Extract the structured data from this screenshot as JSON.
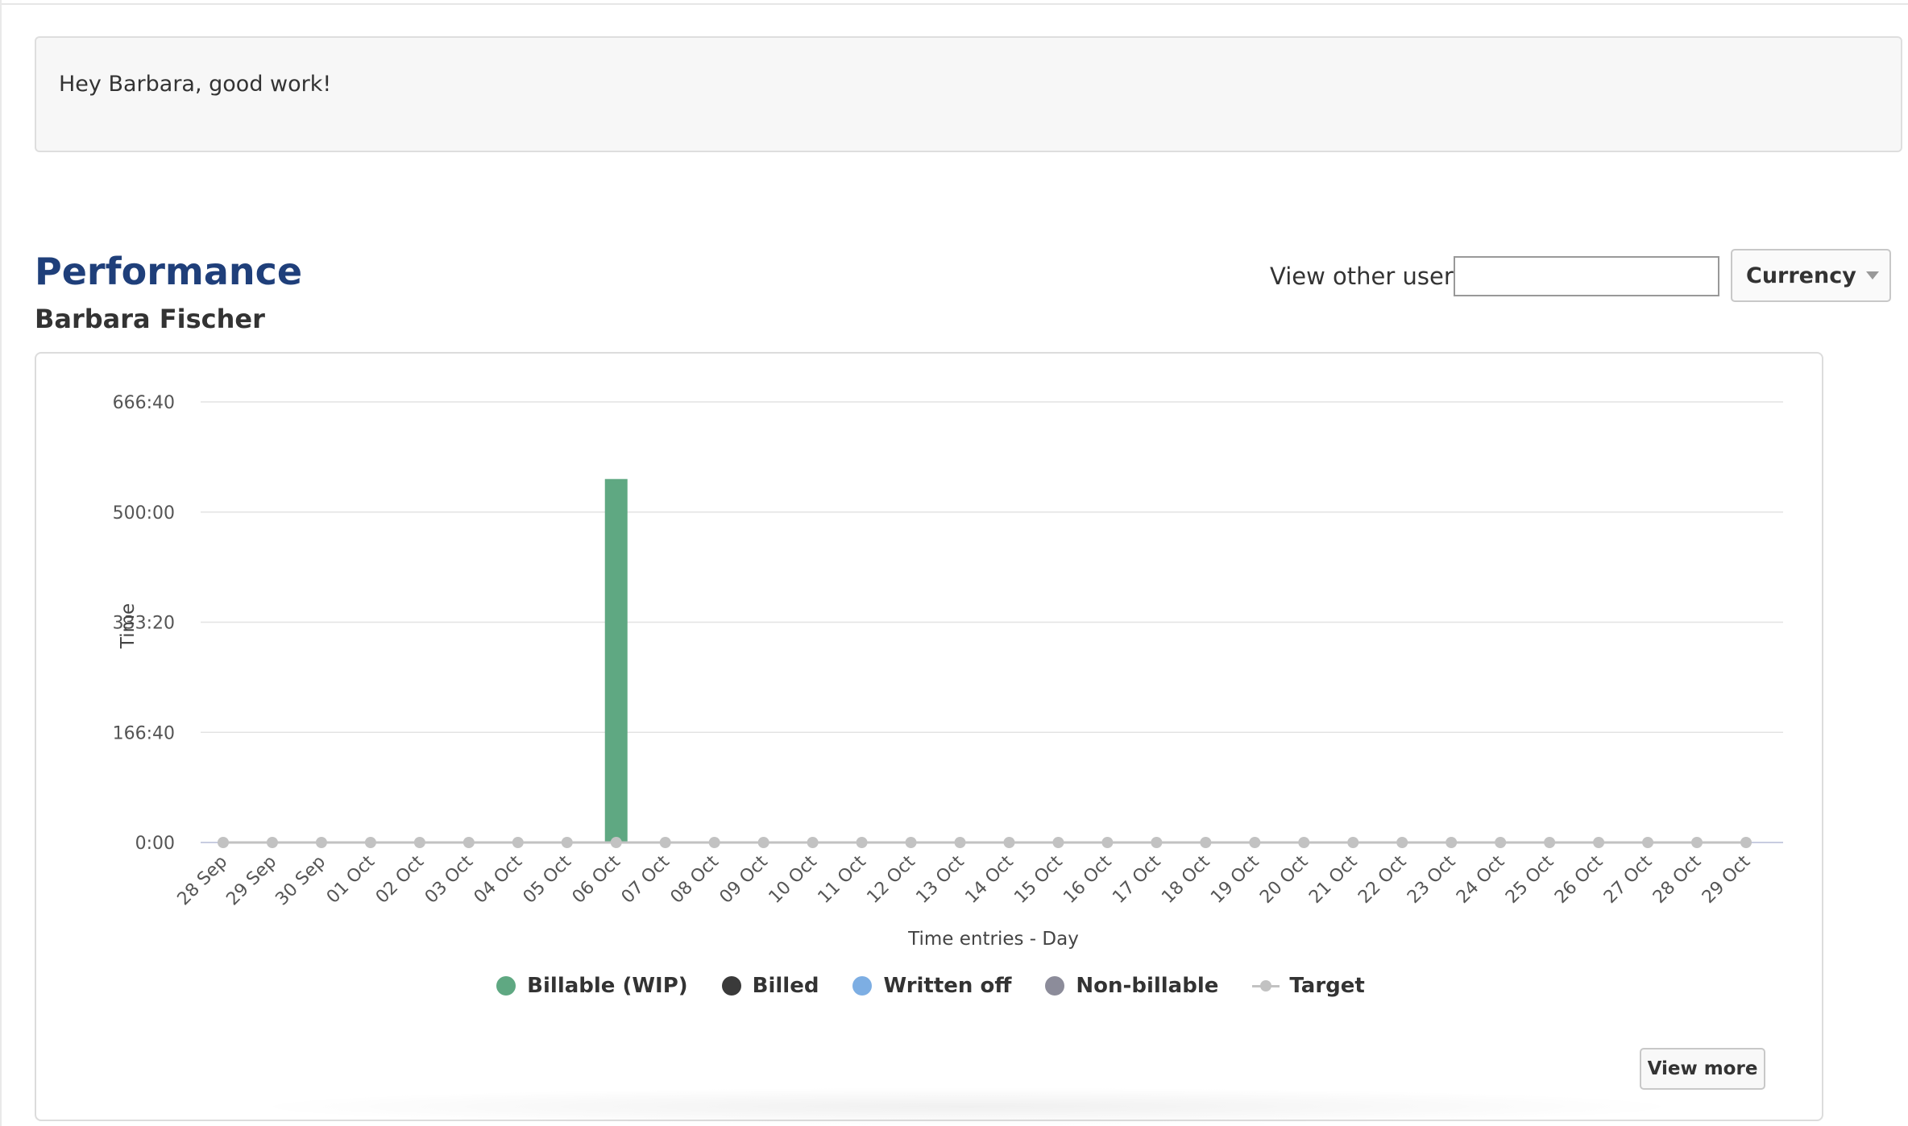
{
  "greeting": "Hey Barbara, good work!",
  "performance": {
    "title": "Performance",
    "user_name": "Barbara Fischer",
    "view_other_user_label": "View other user:",
    "view_other_user_value": "",
    "currency_label": "Currency",
    "view_more_label": "View more"
  },
  "colors": {
    "title": "#1f3f7a",
    "billable": "#5fa882",
    "billed": "#3a3a3a",
    "written_off": "#7daee3",
    "non_billable": "#8c8c9a",
    "target": "#c2c2c2"
  },
  "chart_data": {
    "type": "bar",
    "xlabel": "Time entries - Day",
    "ylabel": "Time",
    "y_ticks": [
      "0:00",
      "166:40",
      "333:20",
      "500:00",
      "666:40"
    ],
    "ylim_minutes": [
      0,
      40000
    ],
    "categories": [
      "28 Sep",
      "29 Sep",
      "30 Sep",
      "01 Oct",
      "02 Oct",
      "03 Oct",
      "04 Oct",
      "05 Oct",
      "06 Oct",
      "07 Oct",
      "08 Oct",
      "09 Oct",
      "10 Oct",
      "11 Oct",
      "12 Oct",
      "13 Oct",
      "14 Oct",
      "15 Oct",
      "16 Oct",
      "17 Oct",
      "18 Oct",
      "19 Oct",
      "20 Oct",
      "21 Oct",
      "22 Oct",
      "23 Oct",
      "24 Oct",
      "25 Oct",
      "26 Oct",
      "27 Oct",
      "28 Oct",
      "29 Oct"
    ],
    "series": [
      {
        "name": "Billable (WIP)",
        "kind": "bar",
        "color": "#5fa882",
        "values_minutes": [
          0,
          0,
          0,
          0,
          0,
          0,
          0,
          0,
          33000,
          0,
          0,
          0,
          0,
          0,
          0,
          0,
          0,
          0,
          0,
          0,
          0,
          0,
          0,
          0,
          0,
          0,
          0,
          0,
          0,
          0,
          0,
          0
        ]
      },
      {
        "name": "Billed",
        "kind": "bar",
        "color": "#3a3a3a",
        "values_minutes": [
          0,
          0,
          0,
          0,
          0,
          0,
          0,
          0,
          0,
          0,
          0,
          0,
          0,
          0,
          0,
          0,
          0,
          0,
          0,
          0,
          0,
          0,
          0,
          0,
          0,
          0,
          0,
          0,
          0,
          0,
          0,
          0
        ]
      },
      {
        "name": "Written off",
        "kind": "bar",
        "color": "#7daee3",
        "values_minutes": [
          0,
          0,
          0,
          0,
          0,
          0,
          0,
          0,
          0,
          0,
          0,
          0,
          0,
          0,
          0,
          0,
          0,
          0,
          0,
          0,
          0,
          0,
          0,
          0,
          0,
          0,
          0,
          0,
          0,
          0,
          0,
          0
        ]
      },
      {
        "name": "Non-billable",
        "kind": "bar",
        "color": "#8c8c9a",
        "values_minutes": [
          0,
          0,
          0,
          0,
          0,
          0,
          0,
          0,
          0,
          0,
          0,
          0,
          0,
          0,
          0,
          0,
          0,
          0,
          0,
          0,
          0,
          0,
          0,
          0,
          0,
          0,
          0,
          0,
          0,
          0,
          0,
          0
        ]
      },
      {
        "name": "Target",
        "kind": "line",
        "color": "#c2c2c2",
        "values_minutes": [
          0,
          0,
          0,
          0,
          0,
          0,
          0,
          0,
          0,
          0,
          0,
          0,
          0,
          0,
          0,
          0,
          0,
          0,
          0,
          0,
          0,
          0,
          0,
          0,
          0,
          0,
          0,
          0,
          0,
          0,
          0,
          0
        ]
      }
    ],
    "grid": true,
    "legend": "bottom-center"
  }
}
